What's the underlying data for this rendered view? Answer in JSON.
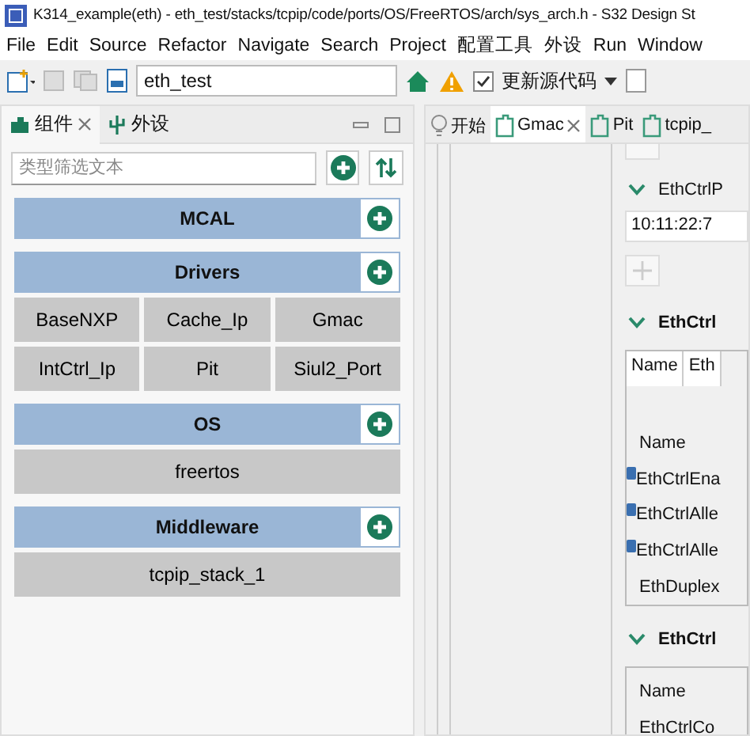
{
  "window": {
    "title": "K314_example(eth) - eth_test/stacks/tcpip/code/ports/OS/FreeRTOS/arch/sys_arch.h - S32 Design St"
  },
  "menu": [
    "File",
    "Edit",
    "Source",
    "Refactor",
    "Navigate",
    "Search",
    "Project",
    "配置工具",
    "外设",
    "Run",
    "Window"
  ],
  "toolbar": {
    "project": "eth_test",
    "update_label": "更新源代码",
    "update_checked": true
  },
  "left_tabs": [
    {
      "label": "组件",
      "selected": true,
      "closable": true
    },
    {
      "label": "外设",
      "selected": false,
      "closable": false
    }
  ],
  "filter": {
    "placeholder": "类型筛选文本"
  },
  "categories": [
    {
      "name": "MCAL"
    },
    {
      "name": "Drivers",
      "items": [
        "BaseNXP",
        "Cache_Ip",
        "Gmac",
        "IntCtrl_Ip",
        "Pit",
        "Siul2_Port"
      ]
    },
    {
      "name": "OS",
      "items": [
        "freertos"
      ]
    },
    {
      "name": "Middleware",
      "items": [
        "tcpip_stack_1"
      ]
    }
  ],
  "editor_tabs": [
    {
      "label": "开始",
      "selected": false,
      "closable": false,
      "kind": "start"
    },
    {
      "label": "Gmac",
      "selected": true,
      "closable": true,
      "kind": "config"
    },
    {
      "label": "Pit",
      "selected": false,
      "closable": false,
      "kind": "config"
    },
    {
      "label": "tcpip_",
      "selected": false,
      "closable": false,
      "kind": "config"
    }
  ],
  "editor": {
    "section1": "EthCtrlP",
    "mac_value": "10:11:22:7",
    "section2": "EthCtrl",
    "table_headers": [
      "Name",
      "Eth"
    ],
    "name_label": "Name",
    "rows": [
      {
        "text": "EthCtrlEna",
        "info": true
      },
      {
        "text": "EthCtrlAlle",
        "info": true
      },
      {
        "text": "EthCtrlAlle",
        "info": true
      },
      {
        "text": "EthDuplex",
        "info": false
      }
    ],
    "section3": "EthCtrl",
    "table2_header": "Name",
    "table2_row": "EthCtrlCo"
  }
}
